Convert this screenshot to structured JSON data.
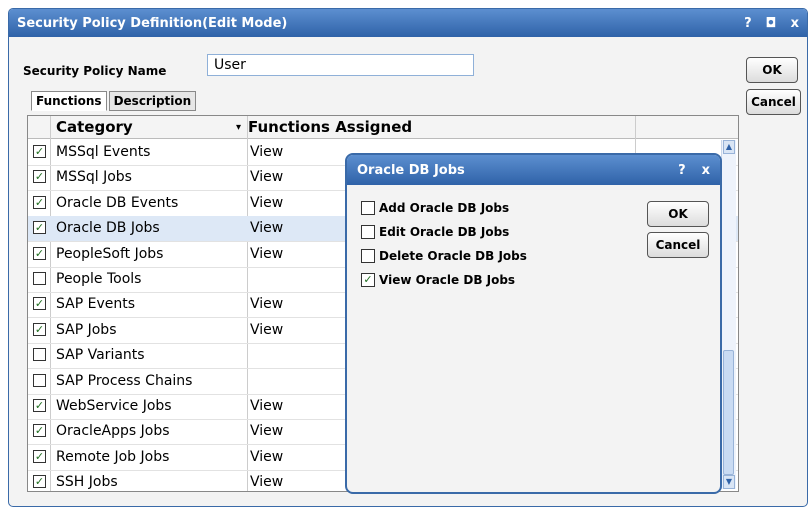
{
  "window": {
    "title": "Security Policy Definition(Edit Mode)",
    "help_label": "?",
    "max_label": "◘",
    "close_label": "x"
  },
  "form": {
    "policy_name_label": "Security Policy Name",
    "policy_name_value": "User",
    "ok_label": "OK",
    "cancel_label": "Cancel"
  },
  "tabs": [
    {
      "label": "Functions",
      "active": true
    },
    {
      "label": "Description",
      "active": false
    }
  ],
  "grid": {
    "col_category": "Category",
    "col_functions": "Functions Assigned",
    "sort_indicator": "▾",
    "rows": [
      {
        "category": "MSSql Events",
        "functions": "View",
        "checked": true
      },
      {
        "category": "MSSql Jobs",
        "functions": "View",
        "checked": true
      },
      {
        "category": "Oracle DB Events",
        "functions": "View",
        "checked": true
      },
      {
        "category": "Oracle DB Jobs",
        "functions": "View",
        "checked": true,
        "selected": true
      },
      {
        "category": "PeopleSoft Jobs",
        "functions": "View",
        "checked": true
      },
      {
        "category": "People Tools",
        "functions": "",
        "checked": false
      },
      {
        "category": "SAP Events",
        "functions": "View",
        "checked": true
      },
      {
        "category": "SAP Jobs",
        "functions": "View",
        "checked": true
      },
      {
        "category": "SAP Variants",
        "functions": "",
        "checked": false
      },
      {
        "category": "SAP Process Chains",
        "functions": "",
        "checked": false
      },
      {
        "category": "WebService Jobs",
        "functions": "View",
        "checked": true
      },
      {
        "category": "OracleApps Jobs",
        "functions": "View",
        "checked": true
      },
      {
        "category": "Remote Job Jobs",
        "functions": "View",
        "checked": true
      },
      {
        "category": "SSH Jobs",
        "functions": "View",
        "checked": true
      }
    ]
  },
  "dialog": {
    "title": "Oracle DB Jobs",
    "help_label": "?",
    "close_label": "x",
    "ok_label": "OK",
    "cancel_label": "Cancel",
    "options": [
      {
        "label": "Add Oracle DB Jobs",
        "checked": false
      },
      {
        "label": "Edit Oracle DB Jobs",
        "checked": false
      },
      {
        "label": "Delete Oracle DB Jobs",
        "checked": false
      },
      {
        "label": "View Oracle DB Jobs",
        "checked": true
      }
    ]
  },
  "colors": {
    "titlebar": "#2f62a8",
    "selected_row": "#dde8f6",
    "check_mark": "#1e6d1e"
  },
  "check_glyph": "✓"
}
